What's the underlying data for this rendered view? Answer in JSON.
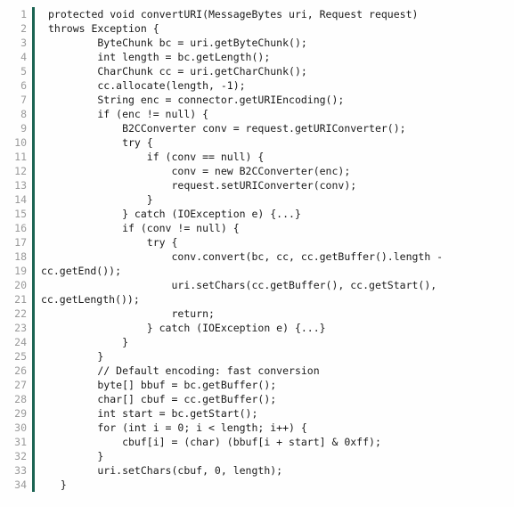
{
  "listing": {
    "language": "java",
    "background_color": "#fefefe",
    "text_color": "#1a1a1a",
    "gutter_color": "#9a9a9a",
    "rail_color": "#1a6352",
    "first_line_number": 1,
    "last_line_number": 34,
    "lines": [
      {
        "number": "1",
        "text": "protected void convertURI(MessageBytes uri, Request request)",
        "wrapped": false
      },
      {
        "number": "2",
        "text": "throws Exception {",
        "wrapped": false
      },
      {
        "number": "3",
        "text": "        ByteChunk bc = uri.getByteChunk();",
        "wrapped": false
      },
      {
        "number": "4",
        "text": "        int length = bc.getLength();",
        "wrapped": false
      },
      {
        "number": "5",
        "text": "        CharChunk cc = uri.getCharChunk();",
        "wrapped": false
      },
      {
        "number": "6",
        "text": "        cc.allocate(length, -1);",
        "wrapped": false
      },
      {
        "number": "7",
        "text": "        String enc = connector.getURIEncoding();",
        "wrapped": false
      },
      {
        "number": "8",
        "text": "        if (enc != null) {",
        "wrapped": false
      },
      {
        "number": "9",
        "text": "            B2CConverter conv = request.getURIConverter();",
        "wrapped": false
      },
      {
        "number": "10",
        "text": "            try {",
        "wrapped": false
      },
      {
        "number": "11",
        "text": "                if (conv == null) {",
        "wrapped": false
      },
      {
        "number": "12",
        "text": "                    conv = new B2CConverter(enc);",
        "wrapped": false
      },
      {
        "number": "13",
        "text": "                    request.setURIConverter(conv);",
        "wrapped": false
      },
      {
        "number": "14",
        "text": "                }",
        "wrapped": false
      },
      {
        "number": "15",
        "text": "            } catch (IOException e) {...}",
        "wrapped": false
      },
      {
        "number": "16",
        "text": "            if (conv != null) {",
        "wrapped": false
      },
      {
        "number": "17",
        "text": "                try {",
        "wrapped": false
      },
      {
        "number": "18",
        "text": "                    conv.convert(bc, cc, cc.getBuffer().length -",
        "wrapped": false
      },
      {
        "number": "19",
        "text": "cc.getEnd());",
        "wrapped": true
      },
      {
        "number": "20",
        "text": "                    uri.setChars(cc.getBuffer(), cc.getStart(),",
        "wrapped": false
      },
      {
        "number": "21",
        "text": "cc.getLength());",
        "wrapped": true
      },
      {
        "number": "22",
        "text": "                    return;",
        "wrapped": false
      },
      {
        "number": "23",
        "text": "                } catch (IOException e) {...}",
        "wrapped": false
      },
      {
        "number": "24",
        "text": "            }",
        "wrapped": false
      },
      {
        "number": "25",
        "text": "        }",
        "wrapped": false
      },
      {
        "number": "26",
        "text": "        // Default encoding: fast conversion",
        "wrapped": false
      },
      {
        "number": "27",
        "text": "        byte[] bbuf = bc.getBuffer();",
        "wrapped": false
      },
      {
        "number": "28",
        "text": "        char[] cbuf = cc.getBuffer();",
        "wrapped": false
      },
      {
        "number": "29",
        "text": "        int start = bc.getStart();",
        "wrapped": false
      },
      {
        "number": "30",
        "text": "        for (int i = 0; i < length; i++) {",
        "wrapped": false
      },
      {
        "number": "31",
        "text": "            cbuf[i] = (char) (bbuf[i + start] & 0xff);",
        "wrapped": false
      },
      {
        "number": "32",
        "text": "        }",
        "wrapped": false
      },
      {
        "number": "33",
        "text": "        uri.setChars(cbuf, 0, length);",
        "wrapped": false
      },
      {
        "number": "34",
        "text": "  }",
        "wrapped": false
      }
    ]
  }
}
